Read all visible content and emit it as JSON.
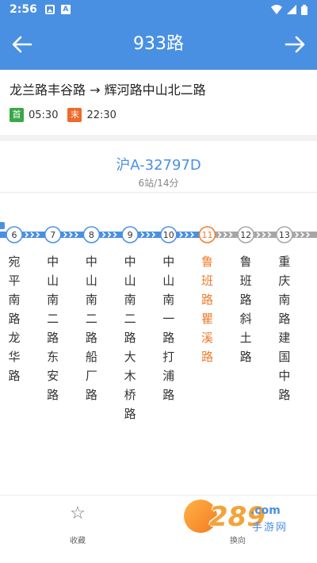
{
  "status_bar": {
    "time": "2:56",
    "icons": [
      "image-icon",
      "a-app-icon",
      "wifi-icon",
      "signal-icon",
      "battery-icon"
    ]
  },
  "header": {
    "title": "933路",
    "back_icon": "arrow-left-icon",
    "forward_icon": "arrow-right-icon"
  },
  "route": {
    "from": "龙兰路丰谷路",
    "arrow": "→",
    "to": "辉河路中山北二路",
    "first_badge": "首",
    "first_time": "05:30",
    "last_badge": "末",
    "last_time": "22:30"
  },
  "bus": {
    "plate": "沪A-32797D",
    "eta": "6站/14分"
  },
  "stops": [
    {
      "num": "6",
      "name": "宛平南路龙华路",
      "active": false
    },
    {
      "num": "7",
      "name": "中山南二路东安路",
      "active": false
    },
    {
      "num": "8",
      "name": "中山南二路船厂路",
      "active": false
    },
    {
      "num": "9",
      "name": "中山南二路大木桥路",
      "active": false
    },
    {
      "num": "10",
      "name": "中山南一路打浦路",
      "active": false
    },
    {
      "num": "11",
      "name": "鲁班路瞿溪路",
      "active": true
    },
    {
      "num": "12",
      "name": "鲁班路斜土路",
      "active": false
    },
    {
      "num": "13",
      "name": "重庆南路建国中路",
      "active": false
    }
  ],
  "colors": {
    "primary": "#4a90e2",
    "passed": "#4a90e2",
    "upcoming": "#a6a6a6",
    "active": "#f07b2a"
  },
  "bottom": {
    "favorite_label": "收藏",
    "favorite_icon": "star-outline-icon",
    "swap_label": "换向"
  },
  "watermark": {
    "number": "289",
    "domain": ".com",
    "text": "手游网"
  }
}
